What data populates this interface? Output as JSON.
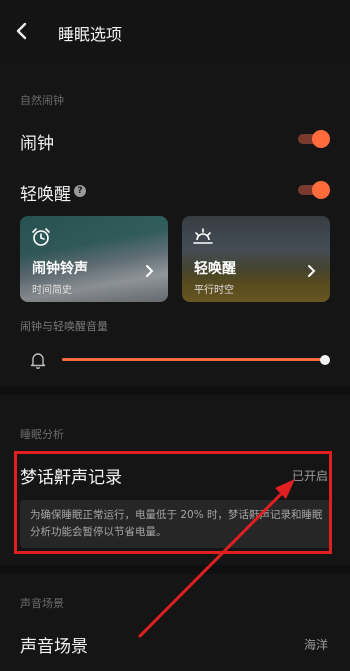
{
  "header": {
    "title": "睡眠选项"
  },
  "alarm_section": {
    "label": "自然闹钟",
    "alarm": {
      "label": "闹钟",
      "enabled": true
    },
    "gentle_wake": {
      "label": "轻唤醒",
      "help": "?",
      "enabled": true
    },
    "cards": [
      {
        "title": "闹钟铃声",
        "subtitle": "时间简史",
        "icon": "alarm-clock-icon"
      },
      {
        "title": "轻唤醒",
        "subtitle": "平行时空",
        "icon": "sunrise-icon"
      }
    ],
    "volume": {
      "label": "闹钟与轻唤醒音量",
      "level_percent": 100
    }
  },
  "analysis_section": {
    "label": "睡眠分析",
    "dream_record": {
      "label": "梦话鼾声记录",
      "value": "已开启"
    },
    "notice": "为确保睡眠正常运行，电量低于 20% 时，梦话鼾声记录和睡眠分析功能会暂停以节省电量。"
  },
  "sound_section": {
    "label": "声音场景",
    "scene": {
      "label": "声音场景",
      "value": "海洋"
    }
  },
  "colors": {
    "accent": "#ff6b3d",
    "annotation": "#e02020",
    "background": "#151515"
  }
}
